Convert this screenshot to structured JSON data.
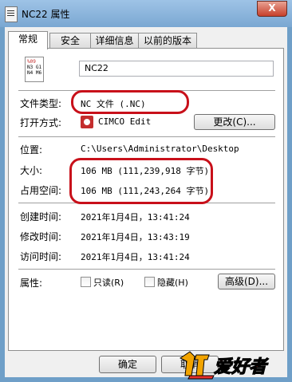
{
  "window": {
    "title": "NC22 属性",
    "close_glyph": "X"
  },
  "tabs": [
    {
      "label": "常规"
    },
    {
      "label": "安全"
    },
    {
      "label": "详细信息"
    },
    {
      "label": "以前的版本"
    }
  ],
  "file_icon": {
    "lines": [
      "%09",
      "N3 G1",
      "N4 M6"
    ]
  },
  "general": {
    "file_name": "NC22",
    "type_label": "文件类型:",
    "type_value": "NC 文件 (.NC)",
    "opens_with_label": "打开方式:",
    "opens_with_value": "CIMCO Edit",
    "change_button": "更改(C)...",
    "location_label": "位置:",
    "location_value": "C:\\Users\\Administrator\\Desktop",
    "size_label": "大小:",
    "size_value": "106 MB (111,239,918 字节)",
    "size_on_disk_label": "占用空间:",
    "size_on_disk_value": "106 MB (111,243,264 字节)",
    "created_label": "创建时间:",
    "created_value": "2021年1月4日，13:41:24",
    "modified_label": "修改时间:",
    "modified_value": "2021年1月4日，13:43:19",
    "accessed_label": "访问时间:",
    "accessed_value": "2021年1月4日，13:41:24",
    "attributes_label": "属性:",
    "readonly_label": "只读(R)",
    "hidden_label": "隐藏(H)",
    "advanced_button": "高级(D)..."
  },
  "footer": {
    "ok_button": "确定",
    "cancel_button": "取消"
  },
  "watermark": {
    "text": "爱好者"
  },
  "colors": {
    "highlight_oval": "#c8101a",
    "title_bar": "#9ec3e6",
    "close_button": "#c7402b"
  }
}
